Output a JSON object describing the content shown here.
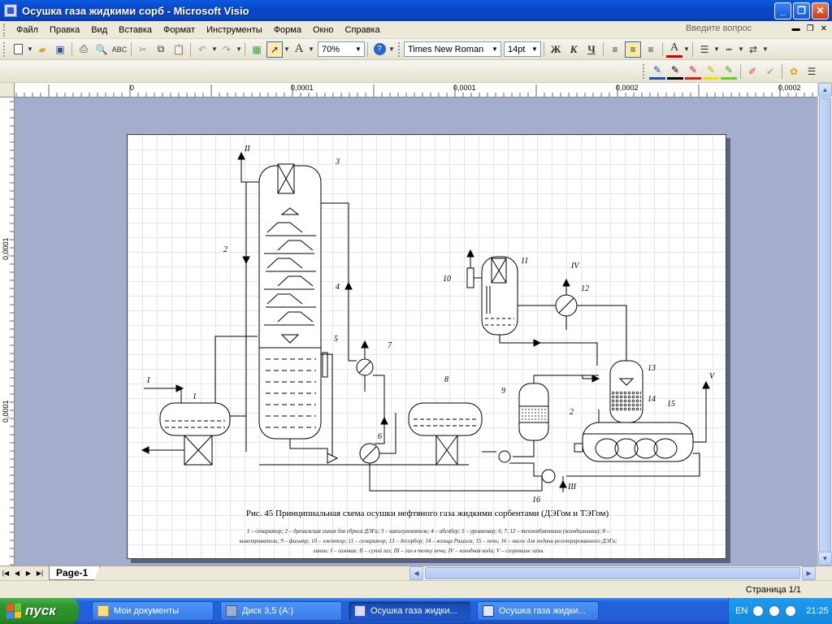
{
  "window": {
    "title": "Осушка газа жидкими сорб - Microsoft Visio"
  },
  "menu": {
    "items": [
      "Файл",
      "Правка",
      "Вид",
      "Вставка",
      "Формат",
      "Инструменты",
      "Форма",
      "Окно",
      "Справка"
    ],
    "ask_placeholder": "Введите вопрос"
  },
  "toolbar": {
    "zoom": "70%",
    "font": "Times New Roman",
    "font_size": "14pt",
    "bold": "Ж",
    "italic": "К",
    "underline": "Ч",
    "text_tool": "A"
  },
  "ruler": {
    "h_labels": [
      "0",
      "0,0001",
      "0,0001",
      "0,0002",
      "0,0002"
    ],
    "v_labels": [
      "0,0001",
      "0,0001"
    ]
  },
  "drawing": {
    "labels": [
      "I",
      "II",
      "III",
      "IV",
      "V",
      "1",
      "2",
      "2",
      "3",
      "4",
      "5",
      "6",
      "7",
      "8",
      "9",
      "10",
      "11",
      "12",
      "13",
      "14",
      "15",
      "16"
    ],
    "caption": "Рис. 45 Принципиальная схема осушки нефтяного газа жидкими сорбентами (ДЭГом и ТЭГом)",
    "legend_1": "1 – сепаратор; 2 – дренажная линия для сброса ДЭГа; 3 – каплеуловитель; 4 – абсобер; 5 – уровнемер; 6, 7, 12 – теплообменники (холодильники); 8 –",
    "legend_2": "выветриватель; 9 – фильтр; 10 – эжектор; 11 – сепаратор; 13 – десорбер; 14 – кольца Рашига; 15 – печь; 16 – насос для подачи регенерированного ДЭГа;",
    "legend_3": "линии: I – газовая; II – сухой газ; III – газ в топку печи; IV – холодная вода; V – сгоревшие газы"
  },
  "tabs": {
    "page_tab": "Page-1"
  },
  "status": {
    "page": "Страница 1/1"
  },
  "taskbar": {
    "start": "пуск",
    "items": [
      "Мои документы",
      "Диск 3,5 (A:)",
      "Осушка газа жидки...",
      "Осушка газа жидки..."
    ],
    "lang": "EN",
    "clock": "21:25"
  }
}
